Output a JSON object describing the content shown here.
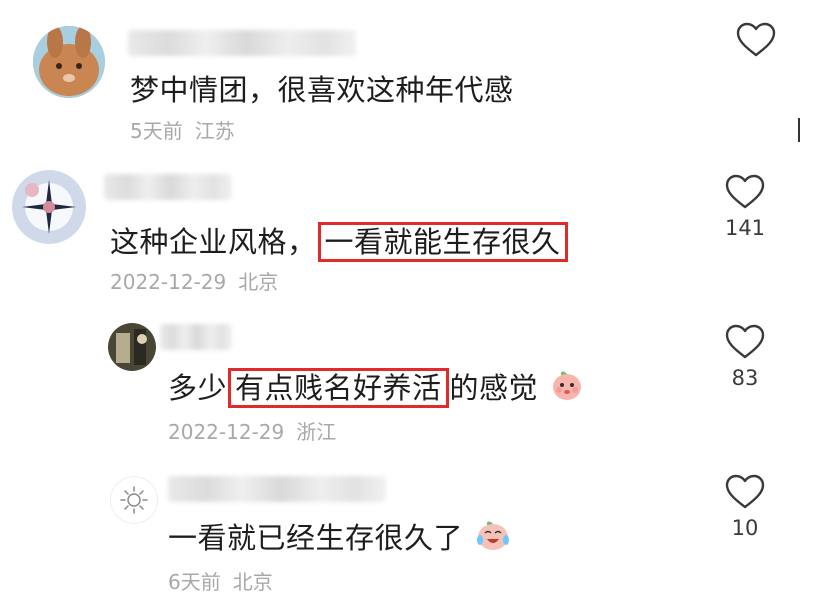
{
  "comments": [
    {
      "text_parts": [
        "梦中情团，很喜欢这种年代感"
      ],
      "meta": {
        "time": "5天前",
        "location": "江苏"
      },
      "likes": "",
      "avatar": "rabbit-avatar"
    },
    {
      "text_parts": [
        "这种企业风格，",
        "一看就能生存很久"
      ],
      "meta": {
        "time": "2022-12-29",
        "location": "北京"
      },
      "likes": "141",
      "avatar": "flower-avatar"
    },
    {
      "text_parts": [
        "多少",
        "有点贱名好养活",
        "的感觉"
      ],
      "meta": {
        "time": "2022-12-29",
        "location": "浙江"
      },
      "likes": "83",
      "avatar": "photo-avatar",
      "emoji": "peach-shy-emoji"
    },
    {
      "text_parts": [
        "一看就已经生存很久了"
      ],
      "meta": {
        "time": "6天前",
        "location": "北京"
      },
      "likes": "10",
      "avatar": "sun-avatar",
      "emoji": "laugh-cry-emoji"
    }
  ],
  "colors": {
    "highlight_box": "#e12a2a",
    "meta_text": "#a8a8a8",
    "heart_outline": "#3a3a3a"
  }
}
